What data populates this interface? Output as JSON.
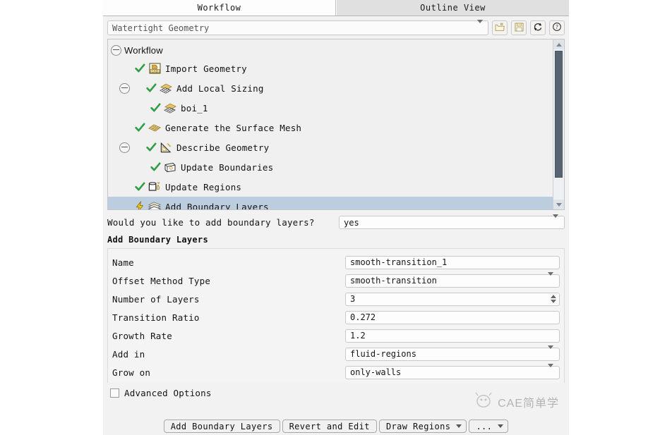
{
  "tabs": [
    {
      "label": "Workflow",
      "active": true
    },
    {
      "label": "Outline View",
      "active": false
    }
  ],
  "toolbar": {
    "workflow_type": "Watertight Geometry",
    "buttons": [
      {
        "name": "open-workflow-button",
        "icon": "folder-open-icon"
      },
      {
        "name": "save-workflow-button",
        "icon": "floppy-save-icon"
      },
      {
        "name": "reset-workflow-button",
        "icon": "refresh-icon"
      },
      {
        "name": "help-button",
        "icon": "question-help-icon"
      }
    ]
  },
  "tree": {
    "root": {
      "label": "Workflow",
      "expanded": true
    },
    "items": [
      {
        "label": "Import Geometry",
        "indent": 1,
        "state": "done",
        "icon": "cad-import-icon",
        "toggle": "none"
      },
      {
        "label": "Add Local Sizing",
        "indent": 1,
        "state": "done",
        "icon": "local-sizing-icon",
        "toggle": "collapse"
      },
      {
        "label": "boi_1",
        "indent": 2,
        "state": "done",
        "icon": "local-sizing-icon",
        "toggle": "none"
      },
      {
        "label": "Generate the Surface Mesh",
        "indent": 1,
        "state": "done",
        "icon": "surface-mesh-icon",
        "toggle": "none"
      },
      {
        "label": "Describe Geometry",
        "indent": 1,
        "state": "done",
        "icon": "describe-geometry-icon",
        "toggle": "collapse"
      },
      {
        "label": "Update Boundaries",
        "indent": 2,
        "state": "done",
        "icon": "boundaries-icon",
        "toggle": "none"
      },
      {
        "label": "Update Regions",
        "indent": 1,
        "state": "done",
        "icon": "regions-icon",
        "toggle": "none"
      },
      {
        "label": "Add Boundary Layers",
        "indent": 1,
        "state": "pending",
        "icon": "boundary-layers-icon",
        "toggle": "none",
        "selected": true
      }
    ]
  },
  "question": {
    "label": "Would you like to add boundary layers?",
    "value": "yes"
  },
  "section_title": "Add Boundary Layers",
  "properties": [
    {
      "label": "Name",
      "value": "smooth-transition_1",
      "type": "text"
    },
    {
      "label": "Offset Method Type",
      "value": "smooth-transition",
      "type": "combo"
    },
    {
      "label": "Number of Layers",
      "value": "3",
      "type": "spinner"
    },
    {
      "label": "Transition Ratio",
      "value": "0.272",
      "type": "text"
    },
    {
      "label": "Growth Rate",
      "value": "1.2",
      "type": "text"
    },
    {
      "label": "Add in",
      "value": "fluid-regions",
      "type": "combo"
    },
    {
      "label": "Grow on",
      "value": "only-walls",
      "type": "combo"
    }
  ],
  "advanced_options": {
    "label": "Advanced Options",
    "checked": false
  },
  "buttons": [
    {
      "label": "Add Boundary Layers",
      "split": false,
      "name": "add-boundary-layers-button"
    },
    {
      "label": "Revert and Edit",
      "split": false,
      "name": "revert-and-edit-button"
    },
    {
      "label": "Draw Regions",
      "split": true,
      "name": "draw-regions-button"
    },
    {
      "label": "...",
      "split": true,
      "name": "more-options-button"
    }
  ],
  "watermark": {
    "text": "CAE简单学"
  },
  "colors": {
    "selection": "#bbcddf",
    "check_green": "#2f9e44",
    "pending_yellow": "#f5c518",
    "panel_bg": "#f2f2f2"
  }
}
